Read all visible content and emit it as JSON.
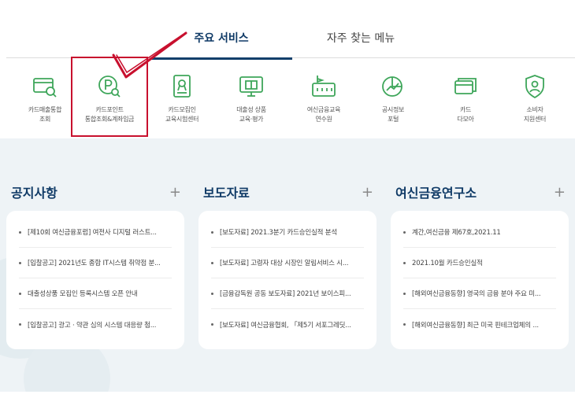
{
  "tabs": [
    {
      "label": "주요 서비스",
      "active": true
    },
    {
      "label": "자주 찾는 메뉴",
      "active": false
    }
  ],
  "services": [
    {
      "label": "카드매출통합\n조회",
      "icon": "card-search-icon"
    },
    {
      "label": "카드포인트\n통합조회&계좌입금",
      "icon": "point-search-icon"
    },
    {
      "label": "카드모집인\n교육시험센터",
      "icon": "certificate-icon"
    },
    {
      "label": "대출성 상품\n교육·평가",
      "icon": "book-monitor-icon"
    },
    {
      "label": "여신금융교육\n연수원",
      "icon": "school-icon"
    },
    {
      "label": "공시정보\n포털",
      "icon": "chart-icon"
    },
    {
      "label": "카드\n다모아",
      "icon": "cards-icon"
    },
    {
      "label": "소비자\n지원센터",
      "icon": "shield-person-icon"
    }
  ],
  "columns": [
    {
      "title": "공지사항",
      "items": [
        "[제10회 여신금융포럼] 여전사 디지털 러스트...",
        "[입찰공고] 2021년도 종합 IT시스템 취약점 분...",
        "대출성상품 모집인 등록시스템 오픈 안내",
        "[입찰공고] 광고 · 약관 심의 시스템 대응량 첨..."
      ]
    },
    {
      "title": "보도자료",
      "items": [
        "[보도자료] 2021.3분기 카드승인실적 분석",
        "[보도자료] 고령자 대상 시장인 알림서비스 시...",
        "[금융감독원 공동 보도자료] 2021년 보이스피...",
        "[보도자료] 여신금융협회, 「제5기 서포그레딧..."
      ]
    },
    {
      "title": "여신금융연구소",
      "items": [
        "계간,여신금융 제67호,2021.11",
        "2021.10월 카드승인실적",
        "[해외여신금융동향] 영국의 금융 분야 주요 미...",
        "[해외여신금융동향] 최근 미국 핀테크업체의 ..."
      ]
    }
  ],
  "colors": {
    "brand_navy": "#0f3a66",
    "icon_green": "#3ea65a",
    "highlight_red": "#c8102e",
    "panel_bg": "#eef3f6"
  }
}
